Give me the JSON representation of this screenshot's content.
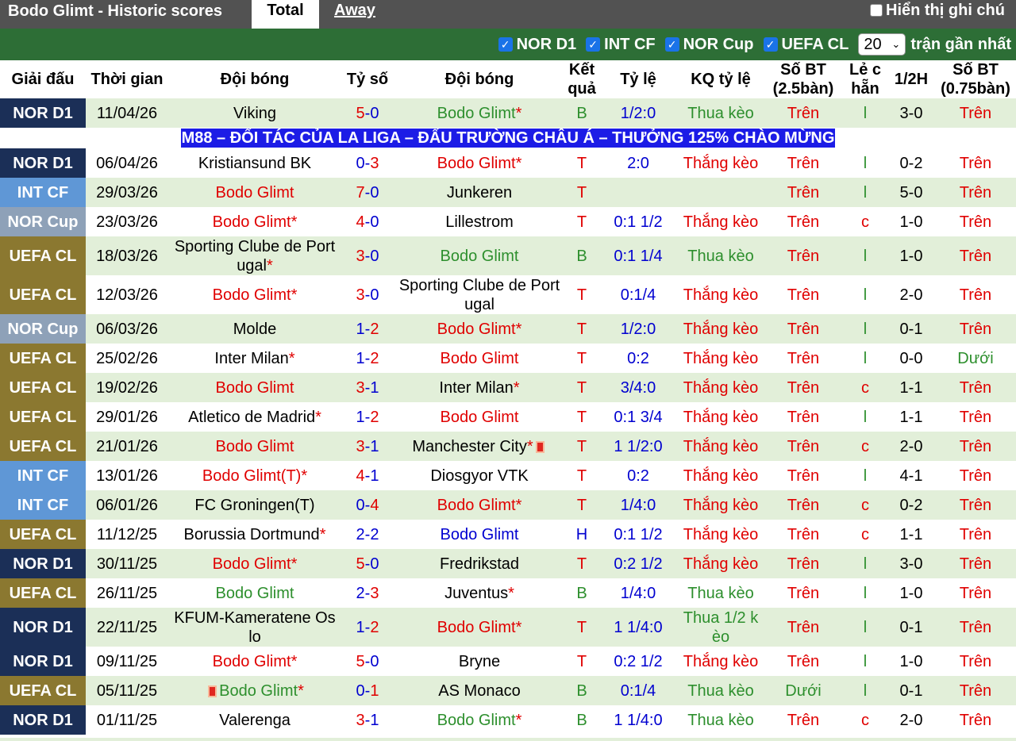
{
  "header": {
    "title": "Bodo Glimt - Historic scores",
    "tab_total": "Total",
    "tab_away": "Away",
    "toggle_label": "Hiển thị ghi chú"
  },
  "filters": {
    "items": [
      "NOR D1",
      "INT CF",
      "NOR Cup",
      "UEFA CL"
    ],
    "count_value": "20",
    "count_suffix": "trận gần nhất"
  },
  "columns": [
    "Giải đấu",
    "Thời gian",
    "Đội bóng",
    "Tỷ số",
    "Đội bóng",
    "Kết quả",
    "Tỷ lệ",
    "KQ tỷ lệ",
    "Số BT (2.5bàn)",
    "Lẻ c hẵn",
    "1/2H",
    "Số BT (0.75bàn)"
  ],
  "ad_text": "M88 – ĐỐI TÁC CỦA LA LIGA – ĐẤU TRƯỜNG CHÂU Á – THƯỞNG 125% CHÀO MỪNG",
  "league_colors": {
    "NOR D1": "#1b2f57",
    "INT CF": "#5f97d6",
    "NOR Cup": "#8ea1b8",
    "UEFA CL": "#8b7830"
  },
  "matches": [
    {
      "league": "NOR D1",
      "date": "11/04/26",
      "home": "Viking",
      "home_color": "black",
      "home_star": false,
      "home_card": false,
      "score_home": "5",
      "score_away": "0",
      "away": "Bodo Glimt",
      "away_color": "green",
      "away_star": true,
      "away_card": false,
      "result": "B",
      "odds": "1/2:0",
      "odds_result": "Thua kèo",
      "ou": "Trên",
      "oe": "l",
      "half": "3-0",
      "ou2": "Trên"
    },
    {
      "league": "NOR D1",
      "date": "06/04/26",
      "home": "Kristiansund BK",
      "home_color": "black",
      "home_star": false,
      "home_card": false,
      "score_home": "0",
      "score_away": "3",
      "away": "Bodo Glimt",
      "away_color": "red",
      "away_star": true,
      "away_card": false,
      "result": "T",
      "odds": "2:0",
      "odds_result": "Thắng kèo",
      "ou": "Trên",
      "oe": "l",
      "half": "0-2",
      "ou2": "Trên"
    },
    {
      "league": "INT CF",
      "date": "29/03/26",
      "home": "Bodo Glimt",
      "home_color": "red",
      "home_star": false,
      "home_card": false,
      "score_home": "7",
      "score_away": "0",
      "away": "Junkeren",
      "away_color": "black",
      "away_star": false,
      "away_card": false,
      "result": "T",
      "odds": "",
      "odds_result": "",
      "ou": "Trên",
      "oe": "l",
      "half": "5-0",
      "ou2": "Trên"
    },
    {
      "league": "NOR Cup",
      "date": "23/03/26",
      "home": "Bodo Glimt",
      "home_color": "red",
      "home_star": true,
      "home_card": false,
      "score_home": "4",
      "score_away": "0",
      "away": "Lillestrom",
      "away_color": "black",
      "away_star": false,
      "away_card": false,
      "result": "T",
      "odds": "0:1 1/2",
      "odds_result": "Thắng kèo",
      "ou": "Trên",
      "oe": "c",
      "half": "1-0",
      "ou2": "Trên"
    },
    {
      "league": "UEFA CL",
      "date": "18/03/26",
      "home": "Sporting Clube de Port ugal",
      "home_color": "black",
      "home_star": true,
      "home_card": false,
      "score_home": "3",
      "score_away": "0",
      "away": "Bodo Glimt",
      "away_color": "green",
      "away_star": false,
      "away_card": false,
      "result": "B",
      "odds": "0:1 1/4",
      "odds_result": "Thua kèo",
      "ou": "Trên",
      "oe": "l",
      "half": "1-0",
      "ou2": "Trên"
    },
    {
      "league": "UEFA CL",
      "date": "12/03/26",
      "home": "Bodo Glimt",
      "home_color": "red",
      "home_star": true,
      "home_card": false,
      "score_home": "3",
      "score_away": "0",
      "away": "Sporting Clube de Port ugal",
      "away_color": "black",
      "away_star": false,
      "away_card": false,
      "result": "T",
      "odds": "0:1/4",
      "odds_result": "Thắng kèo",
      "ou": "Trên",
      "oe": "l",
      "half": "2-0",
      "ou2": "Trên"
    },
    {
      "league": "NOR Cup",
      "date": "06/03/26",
      "home": "Molde",
      "home_color": "black",
      "home_star": false,
      "home_card": false,
      "score_home": "1",
      "score_away": "2",
      "away": "Bodo Glimt",
      "away_color": "red",
      "away_star": true,
      "away_card": false,
      "result": "T",
      "odds": "1/2:0",
      "odds_result": "Thắng kèo",
      "ou": "Trên",
      "oe": "l",
      "half": "0-1",
      "ou2": "Trên"
    },
    {
      "league": "UEFA CL",
      "date": "25/02/26",
      "home": "Inter Milan",
      "home_color": "black",
      "home_star": true,
      "home_card": false,
      "score_home": "1",
      "score_away": "2",
      "away": "Bodo Glimt",
      "away_color": "red",
      "away_star": false,
      "away_card": false,
      "result": "T",
      "odds": "0:2",
      "odds_result": "Thắng kèo",
      "ou": "Trên",
      "oe": "l",
      "half": "0-0",
      "ou2": "Dưới"
    },
    {
      "league": "UEFA CL",
      "date": "19/02/26",
      "home": "Bodo Glimt",
      "home_color": "red",
      "home_star": false,
      "home_card": false,
      "score_home": "3",
      "score_away": "1",
      "away": "Inter Milan",
      "away_color": "black",
      "away_star": true,
      "away_card": false,
      "result": "T",
      "odds": "3/4:0",
      "odds_result": "Thắng kèo",
      "ou": "Trên",
      "oe": "c",
      "half": "1-1",
      "ou2": "Trên"
    },
    {
      "league": "UEFA CL",
      "date": "29/01/26",
      "home": "Atletico de Madrid",
      "home_color": "black",
      "home_star": true,
      "home_card": false,
      "score_home": "1",
      "score_away": "2",
      "away": "Bodo Glimt",
      "away_color": "red",
      "away_star": false,
      "away_card": false,
      "result": "T",
      "odds": "0:1 3/4",
      "odds_result": "Thắng kèo",
      "ou": "Trên",
      "oe": "l",
      "half": "1-1",
      "ou2": "Trên"
    },
    {
      "league": "UEFA CL",
      "date": "21/01/26",
      "home": "Bodo Glimt",
      "home_color": "red",
      "home_star": false,
      "home_card": false,
      "score_home": "3",
      "score_away": "1",
      "away": "Manchester City",
      "away_color": "black",
      "away_star": true,
      "away_card": true,
      "result": "T",
      "odds": "1 1/2:0",
      "odds_result": "Thắng kèo",
      "ou": "Trên",
      "oe": "c",
      "half": "2-0",
      "ou2": "Trên"
    },
    {
      "league": "INT CF",
      "date": "13/01/26",
      "home": "Bodo Glimt(T)",
      "home_color": "red",
      "home_star": true,
      "home_card": false,
      "score_home": "4",
      "score_away": "1",
      "away": "Diosgyor VTK",
      "away_color": "black",
      "away_star": false,
      "away_card": false,
      "result": "T",
      "odds": "0:2",
      "odds_result": "Thắng kèo",
      "ou": "Trên",
      "oe": "l",
      "half": "4-1",
      "ou2": "Trên"
    },
    {
      "league": "INT CF",
      "date": "06/01/26",
      "home": "FC Groningen(T)",
      "home_color": "black",
      "home_star": false,
      "home_card": false,
      "score_home": "0",
      "score_away": "4",
      "away": "Bodo Glimt",
      "away_color": "red",
      "away_star": true,
      "away_card": false,
      "result": "T",
      "odds": "1/4:0",
      "odds_result": "Thắng kèo",
      "ou": "Trên",
      "oe": "c",
      "half": "0-2",
      "ou2": "Trên"
    },
    {
      "league": "UEFA CL",
      "date": "11/12/25",
      "home": "Borussia Dortmund",
      "home_color": "black",
      "home_star": true,
      "home_card": false,
      "score_home": "2",
      "score_away": "2",
      "away": "Bodo Glimt",
      "away_color": "blue",
      "away_star": false,
      "away_card": false,
      "result": "H",
      "odds": "0:1 1/2",
      "odds_result": "Thắng kèo",
      "ou": "Trên",
      "oe": "c",
      "half": "1-1",
      "ou2": "Trên"
    },
    {
      "league": "NOR D1",
      "date": "30/11/25",
      "home": "Bodo Glimt",
      "home_color": "red",
      "home_star": true,
      "home_card": false,
      "score_home": "5",
      "score_away": "0",
      "away": "Fredrikstad",
      "away_color": "black",
      "away_star": false,
      "away_card": false,
      "result": "T",
      "odds": "0:2 1/2",
      "odds_result": "Thắng kèo",
      "ou": "Trên",
      "oe": "l",
      "half": "3-0",
      "ou2": "Trên"
    },
    {
      "league": "UEFA CL",
      "date": "26/11/25",
      "home": "Bodo Glimt",
      "home_color": "green",
      "home_star": false,
      "home_card": false,
      "score_home": "2",
      "score_away": "3",
      "away": "Juventus",
      "away_color": "black",
      "away_star": true,
      "away_card": false,
      "result": "B",
      "odds": "1/4:0",
      "odds_result": "Thua kèo",
      "ou": "Trên",
      "oe": "l",
      "half": "1-0",
      "ou2": "Trên"
    },
    {
      "league": "NOR D1",
      "date": "22/11/25",
      "home": "KFUM-Kameratene Os lo",
      "home_color": "black",
      "home_star": false,
      "home_card": false,
      "score_home": "1",
      "score_away": "2",
      "away": "Bodo Glimt",
      "away_color": "red",
      "away_star": true,
      "away_card": false,
      "result": "T",
      "odds": "1 1/4:0",
      "odds_result": "Thua 1/2 k èo",
      "ou": "Trên",
      "oe": "l",
      "half": "0-1",
      "ou2": "Trên"
    },
    {
      "league": "NOR D1",
      "date": "09/11/25",
      "home": "Bodo Glimt",
      "home_color": "red",
      "home_star": true,
      "home_card": false,
      "score_home": "5",
      "score_away": "0",
      "away": "Bryne",
      "away_color": "black",
      "away_star": false,
      "away_card": false,
      "result": "T",
      "odds": "0:2 1/2",
      "odds_result": "Thắng kèo",
      "ou": "Trên",
      "oe": "l",
      "half": "1-0",
      "ou2": "Trên"
    },
    {
      "league": "UEFA CL",
      "date": "05/11/25",
      "home": "Bodo Glimt",
      "home_color": "green",
      "home_star": true,
      "home_card": true,
      "score_home": "0",
      "score_away": "1",
      "away": "AS Monaco",
      "away_color": "black",
      "away_star": false,
      "away_card": false,
      "result": "B",
      "odds": "0:1/4",
      "odds_result": "Thua kèo",
      "ou": "Dưới",
      "oe": "l",
      "half": "0-1",
      "ou2": "Trên"
    },
    {
      "league": "NOR D1",
      "date": "01/11/25",
      "home": "Valerenga",
      "home_color": "black",
      "home_star": false,
      "home_card": false,
      "score_home": "3",
      "score_away": "1",
      "away": "Bodo Glimt",
      "away_color": "green",
      "away_star": true,
      "away_card": false,
      "result": "B",
      "odds": "1 1/4:0",
      "odds_result": "Thua kèo",
      "ou": "Trên",
      "oe": "c",
      "half": "2-0",
      "ou2": "Trên"
    }
  ]
}
